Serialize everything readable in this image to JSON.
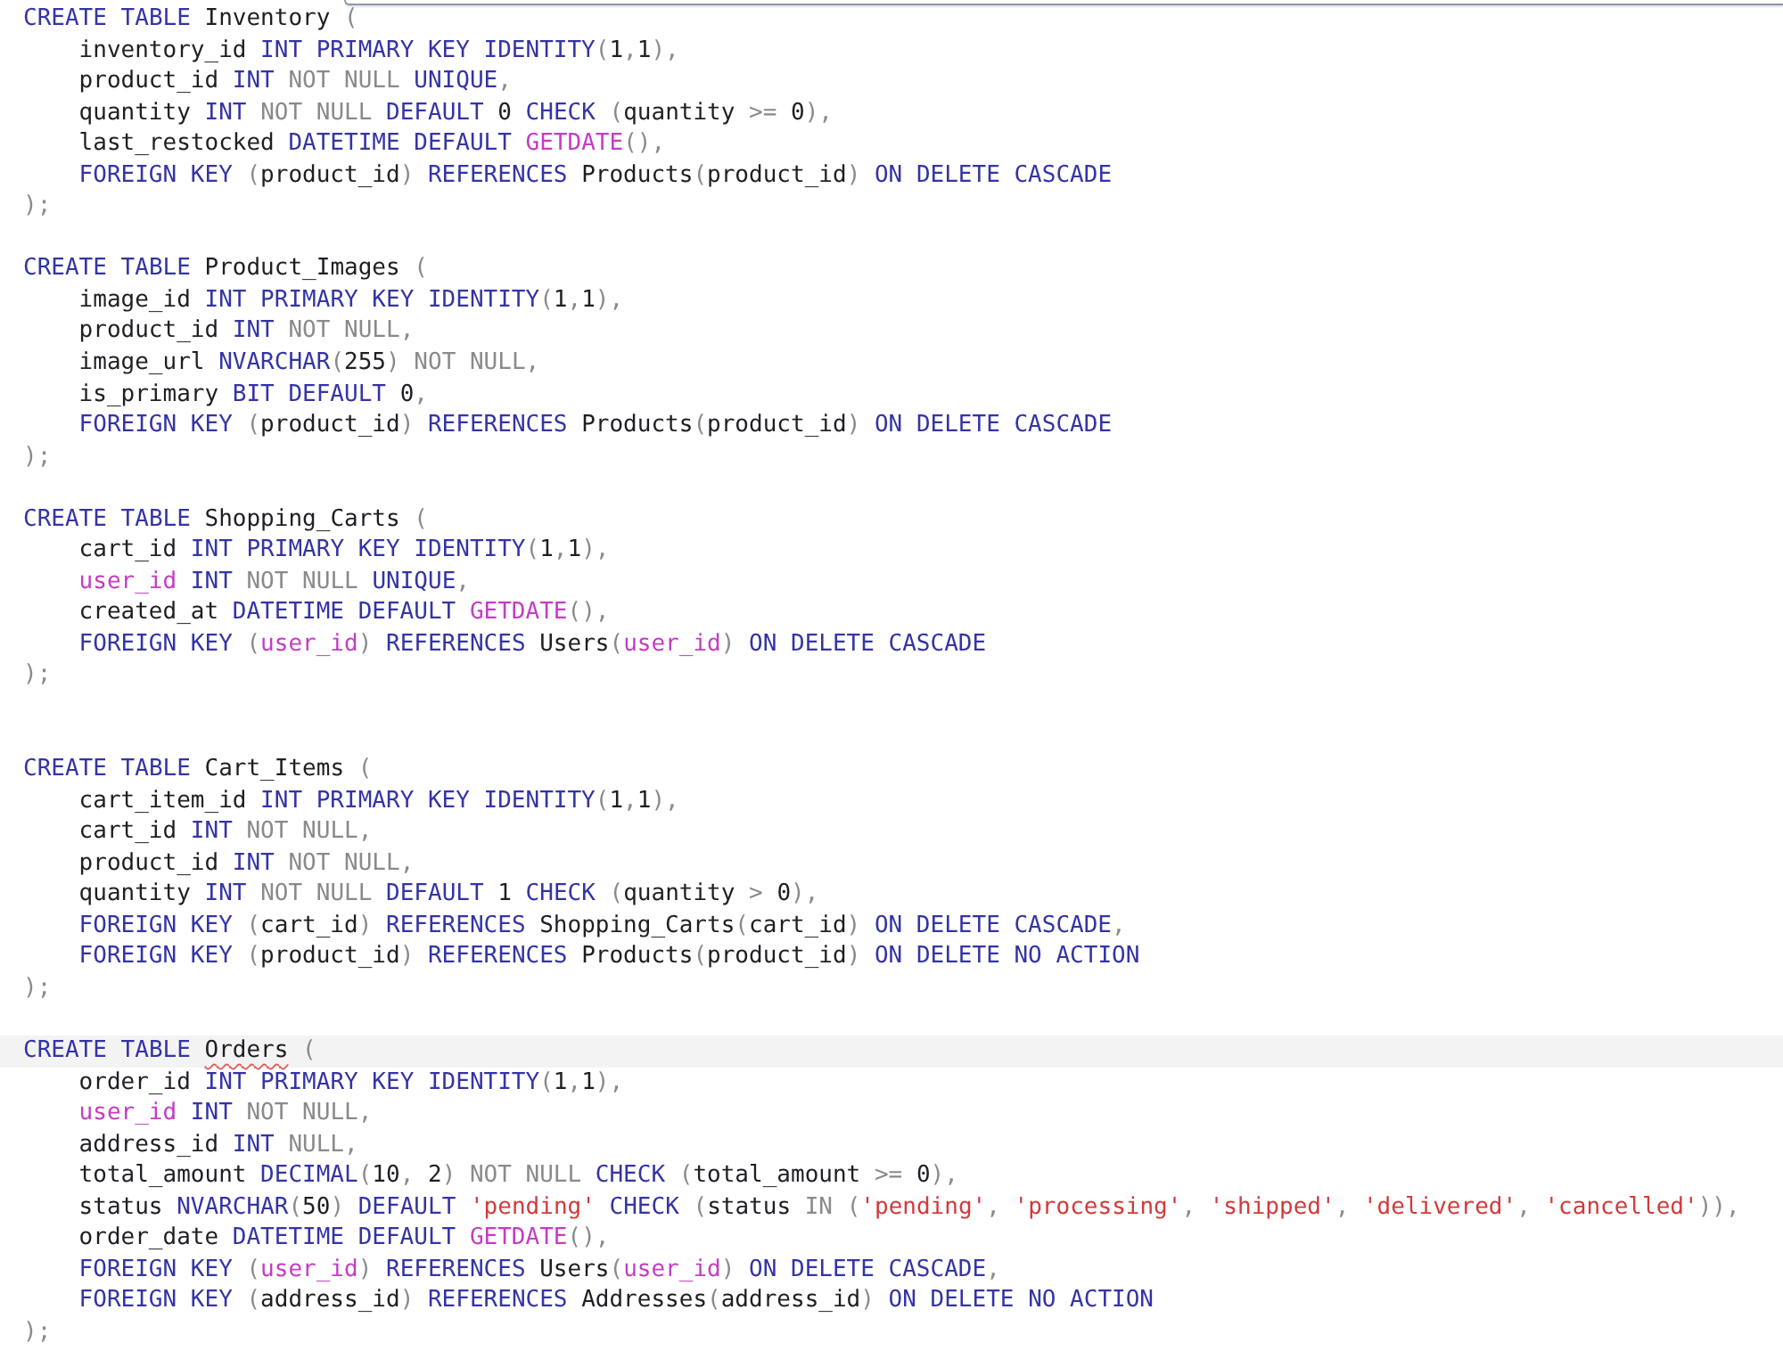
{
  "editor": {
    "lines": [
      {
        "kind": "code",
        "active": false,
        "tokens": [
          {
            "kind": "keyword",
            "text": "CREATE TABLE "
          },
          {
            "kind": "plain",
            "text": "Inventory "
          },
          {
            "kind": "muted",
            "text": "("
          }
        ],
        "children": [
          {
            "kind": "code",
            "active": false,
            "tokens": [
              {
                "kind": "plain",
                "text": "inventory_id "
              },
              {
                "kind": "keyword",
                "text": "INT PRIMARY KEY IDENTITY"
              },
              {
                "kind": "muted",
                "text": "("
              },
              {
                "kind": "plain",
                "text": "1"
              },
              {
                "kind": "muted",
                "text": ","
              },
              {
                "kind": "plain",
                "text": "1"
              },
              {
                "kind": "muted",
                "text": "),"
              }
            ]
          },
          {
            "kind": "code",
            "active": false,
            "tokens": [
              {
                "kind": "plain",
                "text": "product_id "
              },
              {
                "kind": "keyword",
                "text": "INT "
              },
              {
                "kind": "muted",
                "text": "NOT NULL "
              },
              {
                "kind": "keyword",
                "text": "UNIQUE"
              },
              {
                "kind": "muted",
                "text": ","
              }
            ]
          },
          {
            "kind": "code",
            "active": false,
            "tokens": [
              {
                "kind": "plain",
                "text": "quantity "
              },
              {
                "kind": "keyword",
                "text": "INT "
              },
              {
                "kind": "muted",
                "text": "NOT NULL "
              },
              {
                "kind": "keyword",
                "text": "DEFAULT "
              },
              {
                "kind": "plain",
                "text": "0 "
              },
              {
                "kind": "keyword",
                "text": "CHECK "
              },
              {
                "kind": "muted",
                "text": "("
              },
              {
                "kind": "plain",
                "text": "quantity "
              },
              {
                "kind": "muted",
                "text": ">= "
              },
              {
                "kind": "plain",
                "text": "0"
              },
              {
                "kind": "muted",
                "text": "),"
              }
            ]
          },
          {
            "kind": "code",
            "active": false,
            "tokens": [
              {
                "kind": "plain",
                "text": "last_restocked "
              },
              {
                "kind": "keyword",
                "text": "DATETIME DEFAULT "
              },
              {
                "kind": "function",
                "text": "GETDATE"
              },
              {
                "kind": "muted",
                "text": "(),"
              }
            ]
          },
          {
            "kind": "code",
            "active": false,
            "tokens": [
              {
                "kind": "keyword",
                "text": "FOREIGN KEY "
              },
              {
                "kind": "muted",
                "text": "("
              },
              {
                "kind": "plain",
                "text": "product_id"
              },
              {
                "kind": "muted",
                "text": ") "
              },
              {
                "kind": "keyword",
                "text": "REFERENCES "
              },
              {
                "kind": "plain",
                "text": "Products"
              },
              {
                "kind": "muted",
                "text": "("
              },
              {
                "kind": "plain",
                "text": "product_id"
              },
              {
                "kind": "muted",
                "text": ") "
              },
              {
                "kind": "keyword",
                "text": "ON DELETE CASCADE"
              }
            ]
          }
        ]
      },
      {
        "kind": "code",
        "active": false,
        "tokens": [
          {
            "kind": "muted",
            "text": ");"
          }
        ]
      },
      {
        "kind": "blank"
      },
      {
        "kind": "code",
        "active": false,
        "tokens": [
          {
            "kind": "keyword",
            "text": "CREATE TABLE "
          },
          {
            "kind": "plain",
            "text": "Product_Images "
          },
          {
            "kind": "muted",
            "text": "("
          }
        ],
        "children": [
          {
            "kind": "code",
            "active": false,
            "tokens": [
              {
                "kind": "plain",
                "text": "image_id "
              },
              {
                "kind": "keyword",
                "text": "INT PRIMARY KEY IDENTITY"
              },
              {
                "kind": "muted",
                "text": "("
              },
              {
                "kind": "plain",
                "text": "1"
              },
              {
                "kind": "muted",
                "text": ","
              },
              {
                "kind": "plain",
                "text": "1"
              },
              {
                "kind": "muted",
                "text": "),"
              }
            ]
          },
          {
            "kind": "code",
            "active": false,
            "tokens": [
              {
                "kind": "plain",
                "text": "product_id "
              },
              {
                "kind": "keyword",
                "text": "INT "
              },
              {
                "kind": "muted",
                "text": "NOT NULL,"
              }
            ]
          },
          {
            "kind": "code",
            "active": false,
            "tokens": [
              {
                "kind": "plain",
                "text": "image_url "
              },
              {
                "kind": "keyword",
                "text": "NVARCHAR"
              },
              {
                "kind": "muted",
                "text": "("
              },
              {
                "kind": "plain",
                "text": "255"
              },
              {
                "kind": "muted",
                "text": ") NOT NULL,"
              }
            ]
          },
          {
            "kind": "code",
            "active": false,
            "tokens": [
              {
                "kind": "plain",
                "text": "is_primary "
              },
              {
                "kind": "keyword",
                "text": "BIT DEFAULT "
              },
              {
                "kind": "plain",
                "text": "0"
              },
              {
                "kind": "muted",
                "text": ","
              }
            ]
          },
          {
            "kind": "code",
            "active": false,
            "tokens": [
              {
                "kind": "keyword",
                "text": "FOREIGN KEY "
              },
              {
                "kind": "muted",
                "text": "("
              },
              {
                "kind": "plain",
                "text": "product_id"
              },
              {
                "kind": "muted",
                "text": ") "
              },
              {
                "kind": "keyword",
                "text": "REFERENCES "
              },
              {
                "kind": "plain",
                "text": "Products"
              },
              {
                "kind": "muted",
                "text": "("
              },
              {
                "kind": "plain",
                "text": "product_id"
              },
              {
                "kind": "muted",
                "text": ") "
              },
              {
                "kind": "keyword",
                "text": "ON DELETE CASCADE"
              }
            ]
          }
        ]
      },
      {
        "kind": "code",
        "active": false,
        "tokens": [
          {
            "kind": "muted",
            "text": ");"
          }
        ]
      },
      {
        "kind": "blank"
      },
      {
        "kind": "code",
        "active": false,
        "tokens": [
          {
            "kind": "keyword",
            "text": "CREATE TABLE "
          },
          {
            "kind": "plain",
            "text": "Shopping_Carts "
          },
          {
            "kind": "muted",
            "text": "("
          }
        ],
        "children": [
          {
            "kind": "code",
            "active": false,
            "tokens": [
              {
                "kind": "plain",
                "text": "cart_id "
              },
              {
                "kind": "keyword",
                "text": "INT PRIMARY KEY IDENTITY"
              },
              {
                "kind": "muted",
                "text": "("
              },
              {
                "kind": "plain",
                "text": "1"
              },
              {
                "kind": "muted",
                "text": ","
              },
              {
                "kind": "plain",
                "text": "1"
              },
              {
                "kind": "muted",
                "text": "),"
              }
            ]
          },
          {
            "kind": "code",
            "active": false,
            "tokens": [
              {
                "kind": "function",
                "text": "user_id "
              },
              {
                "kind": "keyword",
                "text": "INT "
              },
              {
                "kind": "muted",
                "text": "NOT NULL "
              },
              {
                "kind": "keyword",
                "text": "UNIQUE"
              },
              {
                "kind": "muted",
                "text": ","
              }
            ]
          },
          {
            "kind": "code",
            "active": false,
            "tokens": [
              {
                "kind": "plain",
                "text": "created_at "
              },
              {
                "kind": "keyword",
                "text": "DATETIME DEFAULT "
              },
              {
                "kind": "function",
                "text": "GETDATE"
              },
              {
                "kind": "muted",
                "text": "(),"
              }
            ]
          },
          {
            "kind": "code",
            "active": false,
            "tokens": [
              {
                "kind": "keyword",
                "text": "FOREIGN KEY "
              },
              {
                "kind": "muted",
                "text": "("
              },
              {
                "kind": "function",
                "text": "user_id"
              },
              {
                "kind": "muted",
                "text": ") "
              },
              {
                "kind": "keyword",
                "text": "REFERENCES "
              },
              {
                "kind": "plain",
                "text": "Users"
              },
              {
                "kind": "muted",
                "text": "("
              },
              {
                "kind": "function",
                "text": "user_id"
              },
              {
                "kind": "muted",
                "text": ") "
              },
              {
                "kind": "keyword",
                "text": "ON DELETE CASCADE"
              }
            ]
          }
        ]
      },
      {
        "kind": "code",
        "active": false,
        "tokens": [
          {
            "kind": "muted",
            "text": ");"
          }
        ]
      },
      {
        "kind": "blank"
      },
      {
        "kind": "blank"
      },
      {
        "kind": "code",
        "active": false,
        "tokens": [
          {
            "kind": "keyword",
            "text": "CREATE TABLE "
          },
          {
            "kind": "plain",
            "text": "Cart_Items "
          },
          {
            "kind": "muted",
            "text": "("
          }
        ],
        "children": [
          {
            "kind": "code",
            "active": false,
            "tokens": [
              {
                "kind": "plain",
                "text": "cart_item_id "
              },
              {
                "kind": "keyword",
                "text": "INT PRIMARY KEY IDENTITY"
              },
              {
                "kind": "muted",
                "text": "("
              },
              {
                "kind": "plain",
                "text": "1"
              },
              {
                "kind": "muted",
                "text": ","
              },
              {
                "kind": "plain",
                "text": "1"
              },
              {
                "kind": "muted",
                "text": "),"
              }
            ]
          },
          {
            "kind": "code",
            "active": false,
            "tokens": [
              {
                "kind": "plain",
                "text": "cart_id "
              },
              {
                "kind": "keyword",
                "text": "INT "
              },
              {
                "kind": "muted",
                "text": "NOT NULL,"
              }
            ]
          },
          {
            "kind": "code",
            "active": false,
            "tokens": [
              {
                "kind": "plain",
                "text": "product_id "
              },
              {
                "kind": "keyword",
                "text": "INT "
              },
              {
                "kind": "muted",
                "text": "NOT NULL,"
              }
            ]
          },
          {
            "kind": "code",
            "active": false,
            "tokens": [
              {
                "kind": "plain",
                "text": "quantity "
              },
              {
                "kind": "keyword",
                "text": "INT "
              },
              {
                "kind": "muted",
                "text": "NOT NULL "
              },
              {
                "kind": "keyword",
                "text": "DEFAULT "
              },
              {
                "kind": "plain",
                "text": "1 "
              },
              {
                "kind": "keyword",
                "text": "CHECK "
              },
              {
                "kind": "muted",
                "text": "("
              },
              {
                "kind": "plain",
                "text": "quantity "
              },
              {
                "kind": "muted",
                "text": "> "
              },
              {
                "kind": "plain",
                "text": "0"
              },
              {
                "kind": "muted",
                "text": "),"
              }
            ]
          },
          {
            "kind": "code",
            "active": false,
            "tokens": [
              {
                "kind": "keyword",
                "text": "FOREIGN KEY "
              },
              {
                "kind": "muted",
                "text": "("
              },
              {
                "kind": "plain",
                "text": "cart_id"
              },
              {
                "kind": "muted",
                "text": ") "
              },
              {
                "kind": "keyword",
                "text": "REFERENCES "
              },
              {
                "kind": "plain",
                "text": "Shopping_Carts"
              },
              {
                "kind": "muted",
                "text": "("
              },
              {
                "kind": "plain",
                "text": "cart_id"
              },
              {
                "kind": "muted",
                "text": ") "
              },
              {
                "kind": "keyword",
                "text": "ON DELETE CASCADE"
              },
              {
                "kind": "muted",
                "text": ","
              }
            ]
          },
          {
            "kind": "code",
            "active": false,
            "tokens": [
              {
                "kind": "keyword",
                "text": "FOREIGN KEY "
              },
              {
                "kind": "muted",
                "text": "("
              },
              {
                "kind": "plain",
                "text": "product_id"
              },
              {
                "kind": "muted",
                "text": ") "
              },
              {
                "kind": "keyword",
                "text": "REFERENCES "
              },
              {
                "kind": "plain",
                "text": "Products"
              },
              {
                "kind": "muted",
                "text": "("
              },
              {
                "kind": "plain",
                "text": "product_id"
              },
              {
                "kind": "muted",
                "text": ") "
              },
              {
                "kind": "keyword",
                "text": "ON DELETE NO ACTION"
              }
            ]
          }
        ]
      },
      {
        "kind": "code",
        "active": false,
        "tokens": [
          {
            "kind": "muted",
            "text": ");"
          }
        ]
      },
      {
        "kind": "blank"
      },
      {
        "kind": "code",
        "active": true,
        "tokens": [
          {
            "kind": "keyword",
            "text": "CREATE TABLE "
          },
          {
            "kind": "flagged",
            "text": "Orders"
          },
          {
            "kind": "muted",
            "text": " ("
          }
        ],
        "children": [
          {
            "kind": "code",
            "active": false,
            "tokens": [
              {
                "kind": "plain",
                "text": "order_id "
              },
              {
                "kind": "keyword",
                "text": "INT PRIMARY KEY IDENTITY"
              },
              {
                "kind": "muted",
                "text": "("
              },
              {
                "kind": "plain",
                "text": "1"
              },
              {
                "kind": "muted",
                "text": ","
              },
              {
                "kind": "plain",
                "text": "1"
              },
              {
                "kind": "muted",
                "text": "),"
              }
            ]
          },
          {
            "kind": "code",
            "active": false,
            "tokens": [
              {
                "kind": "function",
                "text": "user_id "
              },
              {
                "kind": "keyword",
                "text": "INT "
              },
              {
                "kind": "muted",
                "text": "NOT NULL,"
              }
            ]
          },
          {
            "kind": "code",
            "active": false,
            "tokens": [
              {
                "kind": "plain",
                "text": "address_id "
              },
              {
                "kind": "keyword",
                "text": "INT "
              },
              {
                "kind": "muted",
                "text": "NULL,"
              }
            ]
          },
          {
            "kind": "code",
            "active": false,
            "tokens": [
              {
                "kind": "plain",
                "text": "total_amount "
              },
              {
                "kind": "keyword",
                "text": "DECIMAL"
              },
              {
                "kind": "muted",
                "text": "("
              },
              {
                "kind": "plain",
                "text": "10"
              },
              {
                "kind": "muted",
                "text": ", "
              },
              {
                "kind": "plain",
                "text": "2"
              },
              {
                "kind": "muted",
                "text": ") NOT NULL "
              },
              {
                "kind": "keyword",
                "text": "CHECK "
              },
              {
                "kind": "muted",
                "text": "("
              },
              {
                "kind": "plain",
                "text": "total_amount "
              },
              {
                "kind": "muted",
                "text": ">= "
              },
              {
                "kind": "plain",
                "text": "0"
              },
              {
                "kind": "muted",
                "text": "),"
              }
            ]
          },
          {
            "kind": "code",
            "active": false,
            "tokens": [
              {
                "kind": "plain",
                "text": "status "
              },
              {
                "kind": "keyword",
                "text": "NVARCHAR"
              },
              {
                "kind": "muted",
                "text": "("
              },
              {
                "kind": "plain",
                "text": "50"
              },
              {
                "kind": "muted",
                "text": ") "
              },
              {
                "kind": "keyword",
                "text": "DEFAULT "
              },
              {
                "kind": "string",
                "text": "'pending' "
              },
              {
                "kind": "keyword",
                "text": "CHECK "
              },
              {
                "kind": "muted",
                "text": "("
              },
              {
                "kind": "plain",
                "text": "status "
              },
              {
                "kind": "muted",
                "text": "IN ("
              },
              {
                "kind": "string",
                "text": "'pending'"
              },
              {
                "kind": "muted",
                "text": ", "
              },
              {
                "kind": "string",
                "text": "'processing'"
              },
              {
                "kind": "muted",
                "text": ", "
              },
              {
                "kind": "string",
                "text": "'shipped'"
              },
              {
                "kind": "muted",
                "text": ", "
              },
              {
                "kind": "string",
                "text": "'delivered'"
              },
              {
                "kind": "muted",
                "text": ", "
              },
              {
                "kind": "string",
                "text": "'cancelled'"
              },
              {
                "kind": "muted",
                "text": ")),"
              }
            ]
          },
          {
            "kind": "code",
            "active": false,
            "tokens": [
              {
                "kind": "plain",
                "text": "order_date "
              },
              {
                "kind": "keyword",
                "text": "DATETIME DEFAULT "
              },
              {
                "kind": "function",
                "text": "GETDATE"
              },
              {
                "kind": "muted",
                "text": "(),"
              }
            ]
          },
          {
            "kind": "code",
            "active": false,
            "tokens": [
              {
                "kind": "keyword",
                "text": "FOREIGN KEY "
              },
              {
                "kind": "muted",
                "text": "("
              },
              {
                "kind": "function",
                "text": "user_id"
              },
              {
                "kind": "muted",
                "text": ") "
              },
              {
                "kind": "keyword",
                "text": "REFERENCES "
              },
              {
                "kind": "plain",
                "text": "Users"
              },
              {
                "kind": "muted",
                "text": "("
              },
              {
                "kind": "function",
                "text": "user_id"
              },
              {
                "kind": "muted",
                "text": ") "
              },
              {
                "kind": "keyword",
                "text": "ON DELETE CASCADE"
              },
              {
                "kind": "muted",
                "text": ","
              }
            ]
          },
          {
            "kind": "code",
            "active": false,
            "tokens": [
              {
                "kind": "keyword",
                "text": "FOREIGN KEY "
              },
              {
                "kind": "muted",
                "text": "("
              },
              {
                "kind": "plain",
                "text": "address_id"
              },
              {
                "kind": "muted",
                "text": ") "
              },
              {
                "kind": "keyword",
                "text": "REFERENCES "
              },
              {
                "kind": "plain",
                "text": "Addresses"
              },
              {
                "kind": "muted",
                "text": "("
              },
              {
                "kind": "plain",
                "text": "address_id"
              },
              {
                "kind": "muted",
                "text": ") "
              },
              {
                "kind": "keyword",
                "text": "ON DELETE NO ACTION"
              }
            ]
          }
        ]
      },
      {
        "kind": "code",
        "active": false,
        "tokens": [
          {
            "kind": "muted",
            "text": ");"
          }
        ]
      }
    ]
  }
}
